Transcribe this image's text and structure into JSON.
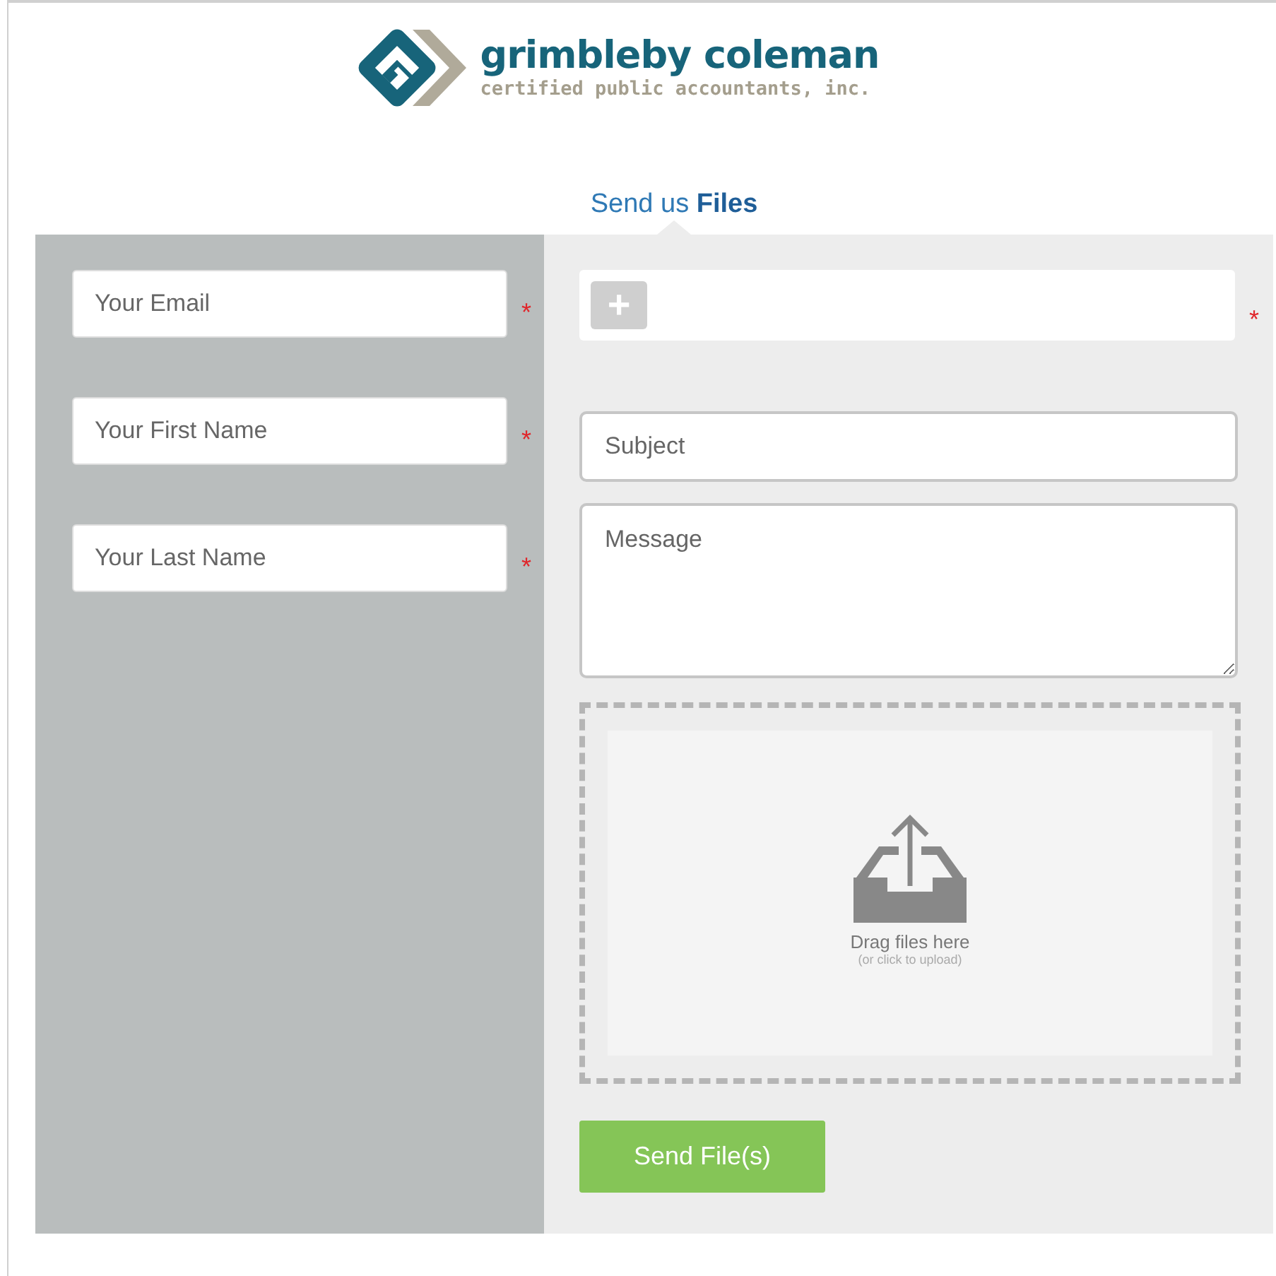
{
  "logo": {
    "name": "grimbleby coleman",
    "tagline": "certified public accountants, inc."
  },
  "heading": "Send us **Files**",
  "contact_fields": [
    {
      "placeholder": "Your Email",
      "required_mark": "*"
    },
    {
      "placeholder": "Your First Name",
      "required_mark": "*"
    },
    {
      "placeholder": "Your Last Name",
      "required_mark": "*"
    }
  ],
  "recipients": {
    "add_button": "+",
    "required_mark": "*"
  },
  "subject": {
    "placeholder": "Subject"
  },
  "message": {
    "placeholder": "Message"
  },
  "dropzone": {
    "title": "Drag files here",
    "hint": "(or click to upload)"
  },
  "send_button": "Send File(s)"
}
